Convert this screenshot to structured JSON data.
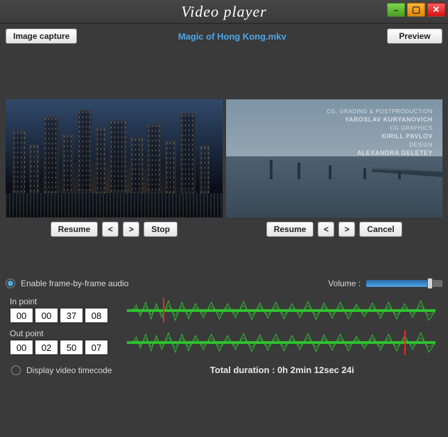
{
  "title": "Video player",
  "header": {
    "image_capture": "Image capture",
    "filename": "Magic of Hong Kong.mkv",
    "preview": "Preview"
  },
  "left": {
    "resume": "Resume",
    "prev": "<",
    "next": ">",
    "stop": "Stop"
  },
  "right": {
    "resume": "Resume",
    "prev": "<",
    "next": ">",
    "cancel": "Cancel",
    "credits": {
      "line1": "CG, GRADING & POSTPRODUCTION",
      "name1": "YAROSLAV KURYANOVICH",
      "line2": "CG GRAPHICS",
      "name2": "KIRILL PAVLOV",
      "line3": "DESIGN",
      "name3": "ALEXANDRA GELETEY"
    }
  },
  "audio": {
    "enable_label": "Enable frame-by-frame audio",
    "volume_label": "Volume :"
  },
  "in_point": {
    "label": "In point",
    "h": "00",
    "m": "00",
    "s": "37",
    "f": "08"
  },
  "out_point": {
    "label": "Out point",
    "h": "00",
    "m": "02",
    "s": "50",
    "f": "07"
  },
  "display_tc": "Display video timecode",
  "duration": "Total duration : 0h 2min 12sec 24i"
}
